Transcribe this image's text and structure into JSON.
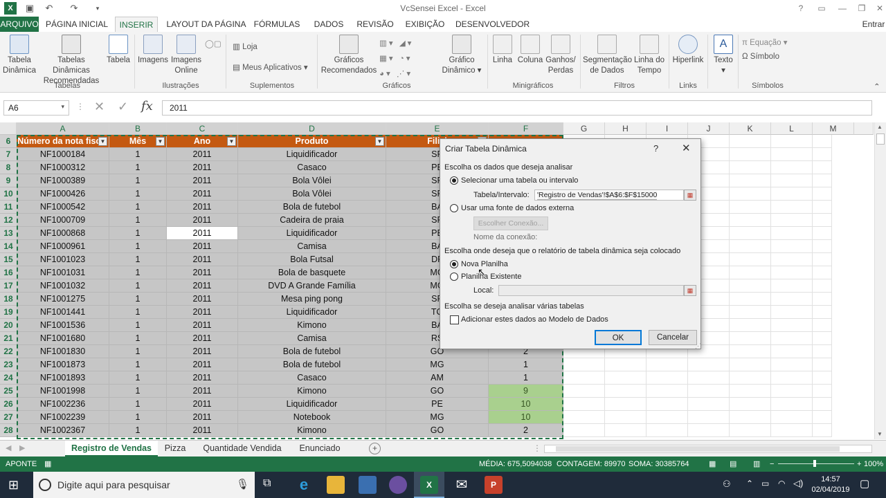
{
  "app": {
    "title": "VcSensei Excel - Excel",
    "signin": "Entrar"
  },
  "tabs": [
    "ARQUIVO",
    "PÁGINA INICIAL",
    "INSERIR",
    "LAYOUT DA PÁGINA",
    "FÓRMULAS",
    "DADOS",
    "REVISÃO",
    "EXIBIÇÃO",
    "DESENVOLVEDOR"
  ],
  "active_tab": "INSERIR",
  "ribbon": {
    "pivot": [
      "Tabela",
      "Dinâmica"
    ],
    "rec_pivot": [
      "Tabelas Dinâmicas",
      "Recomendadas"
    ],
    "table": "Tabela",
    "images": "Imagens",
    "online_images": [
      "Imagens",
      "Online"
    ],
    "store": "Loja",
    "my_apps": "Meus Aplicativos",
    "rec_charts": [
      "Gráficos",
      "Recomendados"
    ],
    "pivot_chart": [
      "Gráfico",
      "Dinâmico"
    ],
    "line": "Linha",
    "column": "Coluna",
    "winloss": [
      "Ganhos/",
      "Perdas"
    ],
    "slicer": [
      "Segmentação",
      "de Dados"
    ],
    "timeline": [
      "Linha do",
      "Tempo"
    ],
    "hyperlink": "Hiperlink",
    "text": "Texto",
    "equation": "Equação",
    "symbol": "Símbolo",
    "groups": [
      "Tabelas",
      "Ilustrações",
      "Suplementos",
      "Gráficos",
      "Minigráficos",
      "Filtros",
      "Links",
      "Símbolos"
    ]
  },
  "formula_bar": {
    "name_box": "A6",
    "value": "2011"
  },
  "columns": [
    "A",
    "B",
    "C",
    "D",
    "E",
    "F",
    "G",
    "H",
    "I",
    "J",
    "K",
    "L",
    "M"
  ],
  "table": {
    "headers": [
      "Número da nota fiscal",
      "Mês",
      "Ano",
      "Produto",
      "Filial",
      ""
    ],
    "rows": [
      {
        "n": "7",
        "a": "NF1000184",
        "b": "1",
        "c": "2011",
        "d": "Liquidificador",
        "e": "SP",
        "f": ""
      },
      {
        "n": "8",
        "a": "NF1000312",
        "b": "1",
        "c": "2011",
        "d": "Casaco",
        "e": "PE",
        "f": ""
      },
      {
        "n": "9",
        "a": "NF1000389",
        "b": "1",
        "c": "2011",
        "d": "Bola Vôlei",
        "e": "SP",
        "f": ""
      },
      {
        "n": "10",
        "a": "NF1000426",
        "b": "1",
        "c": "2011",
        "d": "Bola Vôlei",
        "e": "SP",
        "f": ""
      },
      {
        "n": "11",
        "a": "NF1000542",
        "b": "1",
        "c": "2011",
        "d": "Bola de futebol",
        "e": "BA",
        "f": ""
      },
      {
        "n": "12",
        "a": "NF1000709",
        "b": "1",
        "c": "2011",
        "d": "Cadeira de praia",
        "e": "SP",
        "f": ""
      },
      {
        "n": "13",
        "a": "NF1000868",
        "b": "1",
        "c": "2011",
        "d": "Liquidificador",
        "e": "PE",
        "f": ""
      },
      {
        "n": "14",
        "a": "NF1000961",
        "b": "1",
        "c": "2011",
        "d": "Camisa",
        "e": "BA",
        "f": ""
      },
      {
        "n": "15",
        "a": "NF1001023",
        "b": "1",
        "c": "2011",
        "d": "Bola Futsal",
        "e": "DF",
        "f": ""
      },
      {
        "n": "16",
        "a": "NF1001031",
        "b": "1",
        "c": "2011",
        "d": "Bola de basquete",
        "e": "MG",
        "f": ""
      },
      {
        "n": "17",
        "a": "NF1001032",
        "b": "1",
        "c": "2011",
        "d": "DVD A Grande Família",
        "e": "MG",
        "f": ""
      },
      {
        "n": "18",
        "a": "NF1001275",
        "b": "1",
        "c": "2011",
        "d": "Mesa ping pong",
        "e": "SP",
        "f": ""
      },
      {
        "n": "19",
        "a": "NF1001441",
        "b": "1",
        "c": "2011",
        "d": "Liquidificador",
        "e": "TO",
        "f": ""
      },
      {
        "n": "20",
        "a": "NF1001536",
        "b": "1",
        "c": "2011",
        "d": "Kimono",
        "e": "BA",
        "f": ""
      },
      {
        "n": "21",
        "a": "NF1001680",
        "b": "1",
        "c": "2011",
        "d": "Camisa",
        "e": "RS",
        "f": ""
      },
      {
        "n": "22",
        "a": "NF1001830",
        "b": "1",
        "c": "2011",
        "d": "Bola de futebol",
        "e": "GO",
        "f": "2"
      },
      {
        "n": "23",
        "a": "NF1001873",
        "b": "1",
        "c": "2011",
        "d": "Bola de futebol",
        "e": "MG",
        "f": "1"
      },
      {
        "n": "24",
        "a": "NF1001893",
        "b": "1",
        "c": "2011",
        "d": "Casaco",
        "e": "AM",
        "f": "1"
      },
      {
        "n": "25",
        "a": "NF1001998",
        "b": "1",
        "c": "2011",
        "d": "Kimono",
        "e": "GO",
        "f": "9"
      },
      {
        "n": "26",
        "a": "NF1002236",
        "b": "1",
        "c": "2011",
        "d": "Liquidificador",
        "e": "PE",
        "f": "10"
      },
      {
        "n": "27",
        "a": "NF1002239",
        "b": "1",
        "c": "2011",
        "d": "Notebook",
        "e": "MG",
        "f": "10"
      },
      {
        "n": "28",
        "a": "NF1002367",
        "b": "1",
        "c": "2011",
        "d": "Kimono",
        "e": "GO",
        "f": "2"
      }
    ]
  },
  "sheets": [
    "Registro de Vendas",
    "Pizza",
    "Quantidade Vendida",
    "Enunciado"
  ],
  "status": {
    "mode": "APONTE",
    "avg": "MÉDIA: 675,5094038",
    "count": "CONTAGEM: 89970",
    "sum": "SOMA: 30385764",
    "zoom": "100%"
  },
  "taskbar": {
    "search": "Digite aqui para pesquisar",
    "time": "14:57",
    "date": "02/04/2019"
  },
  "dialog": {
    "title": "Criar Tabela Dinâmica",
    "help": "?",
    "section1": "Escolha os dados que deseja analisar",
    "opt_select": "Selecionar uma tabela ou intervalo",
    "range_label": "Tabela/Intervalo:",
    "range_value": "'Registro de Vendas'!$A$6:$F$15000",
    "opt_external": "Usar uma fonte de dados externa",
    "choose_conn": "Escolher Conexão...",
    "conn_name": "Nome da conexão:",
    "section2": "Escolha onde deseja que o relatório de tabela dinâmica seja colocado",
    "opt_new": "Nova Planilha",
    "opt_existing": "Planilha Existente",
    "local_label": "Local:",
    "section3": "Escolha se deseja analisar várias tabelas",
    "check_model": "Adicionar estes dados ao Modelo de Dados",
    "ok": "OK",
    "cancel": "Cancelar"
  }
}
